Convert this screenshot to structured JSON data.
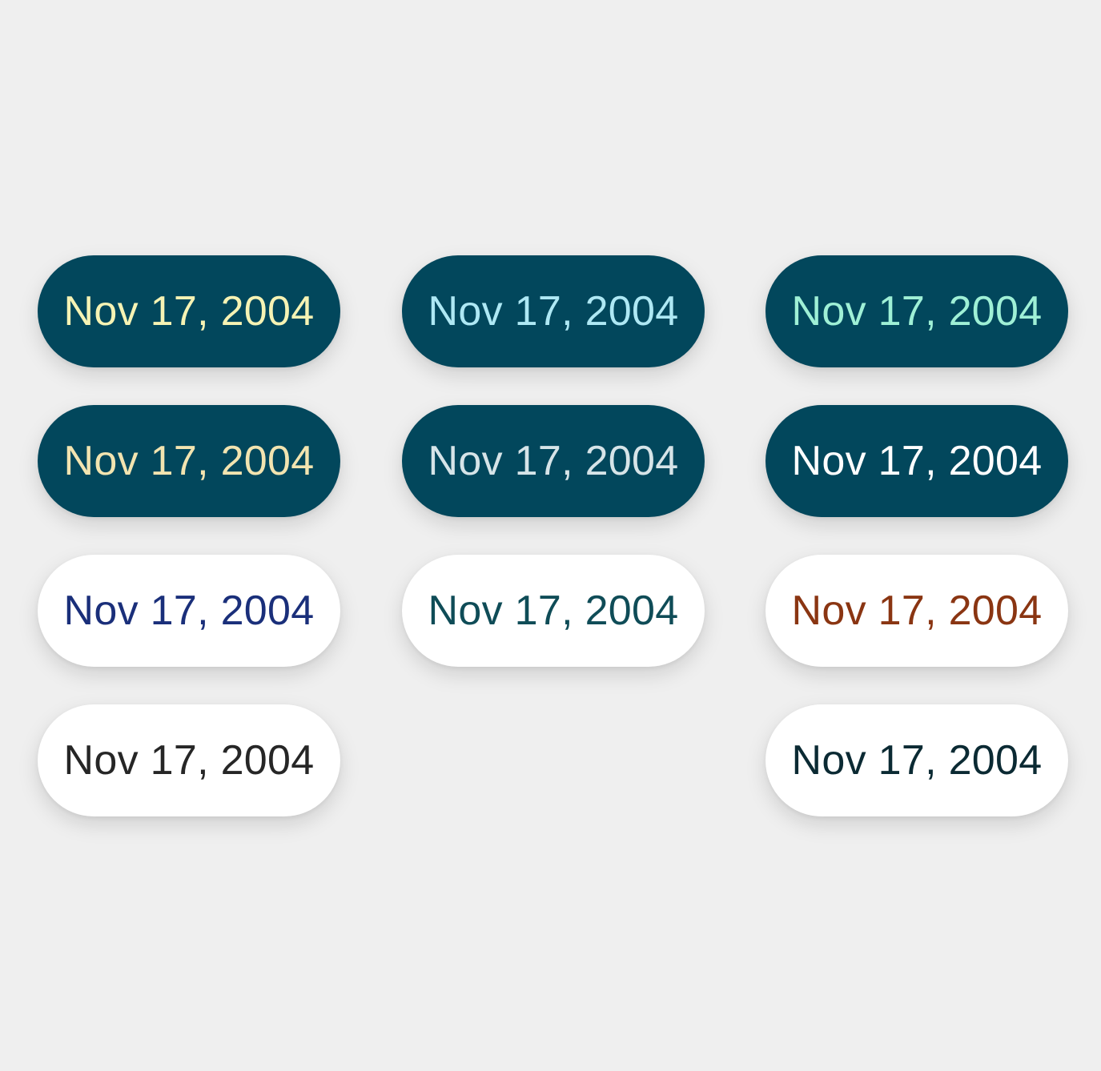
{
  "chips": [
    {
      "label": "Nov 17, 2004",
      "background": "#02475c",
      "text_color": "#f6f3b4"
    },
    {
      "label": "Nov 17, 2004",
      "background": "#02475c",
      "text_color": "#aee8f4"
    },
    {
      "label": "Nov 17, 2004",
      "background": "#02475c",
      "text_color": "#9ff0d6"
    },
    {
      "label": "Nov 17, 2004",
      "background": "#02475c",
      "text_color": "#f2e4b0"
    },
    {
      "label": "Nov 17, 2004",
      "background": "#02475c",
      "text_color": "#d6e4e8"
    },
    {
      "label": "Nov 17, 2004",
      "background": "#02475c",
      "text_color": "#ffffff"
    },
    {
      "label": "Nov 17, 2004",
      "background": "#ffffff",
      "text_color": "#1a2f7a"
    },
    {
      "label": "Nov 17, 2004",
      "background": "#ffffff",
      "text_color": "#0f4c57"
    },
    {
      "label": "Nov 17, 2004",
      "background": "#ffffff",
      "text_color": "#8a3512"
    },
    {
      "label": "Nov 17, 2004",
      "background": "#ffffff",
      "text_color": "#262626"
    },
    {
      "label": "Nov 17, 2004",
      "background": "#ffffff",
      "text_color": "#0b2a33"
    }
  ]
}
